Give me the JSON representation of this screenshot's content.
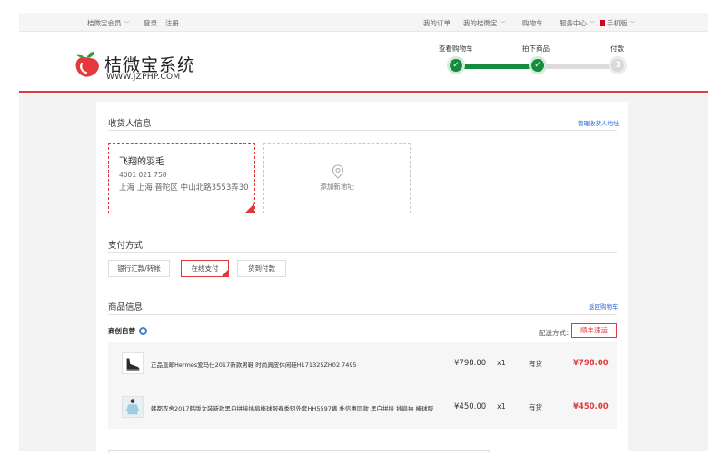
{
  "topbar": {
    "member": "桔微宝会员",
    "login": "登录",
    "register": "注册",
    "my_orders": "我的订单",
    "my_account": "我的桔微宝",
    "cart": "购物车",
    "service": "服务中心",
    "mobile": "手机版"
  },
  "brand": {
    "name": "桔微宝系统",
    "url": "WWW.JZPHP.COM",
    "accent": "#e4393c",
    "step_color": "#158c3c"
  },
  "steps": [
    {
      "label": "查看购物车",
      "state": "done"
    },
    {
      "label": "拍下商品",
      "state": "done"
    },
    {
      "label": "付款",
      "state": "todo",
      "number": "3"
    }
  ],
  "receiver": {
    "title": "收货人信息",
    "manage_link": "管理收货人地址",
    "address": {
      "name": "飞翔的羽毛",
      "phone": "4001 021 758",
      "location": "上海 上海 普陀区 中山北路3553弄30"
    },
    "add_label": "添加新地址"
  },
  "payment": {
    "title": "支付方式",
    "options": [
      "银行汇款/转帐",
      "在线支付",
      "货到付款"
    ],
    "selected": "在线支付"
  },
  "goods": {
    "title": "商品信息",
    "back_link": "返回购物车",
    "shop": "商创自营",
    "shipping_label": "配送方式：",
    "shipping_method": "顺丰速运",
    "items": [
      {
        "name": "正品直邮Hermes爱马仕2017新款男鞋 时尚真皮休闲鞋H171325ZH02 7495",
        "price": "¥798.00",
        "qty": "x1",
        "stock": "有货",
        "total": "¥798.00"
      },
      {
        "name": "韩都衣舍2017韩版女装新款黑白拼接插肩棒球服春季短外套HH5597螨 朴信惠同款 黑白拼接 插肩袖 棒球服",
        "price": "¥450.00",
        "qty": "x1",
        "stock": "有货",
        "total": "¥450.00"
      }
    ]
  }
}
